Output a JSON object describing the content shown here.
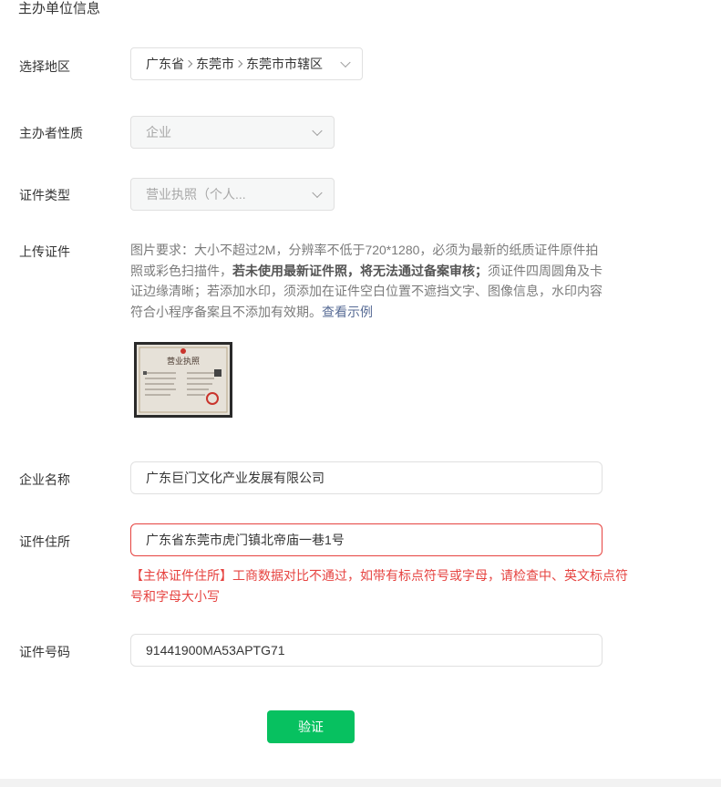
{
  "section": {
    "title": "主办单位信息"
  },
  "region": {
    "label": "选择地区",
    "province": "广东省",
    "city": "东莞市",
    "district": "东莞市市辖区"
  },
  "nature": {
    "label": "主办者性质",
    "value": "企业"
  },
  "cert_type": {
    "label": "证件类型",
    "value": "营业执照（个人..."
  },
  "upload": {
    "label": "上传证件",
    "desc_part1": "图片要求：大小不超过2M，分辨率不低于720*1280，必须为最新的纸质证件原件拍照或彩色扫描件，",
    "desc_bold": "若未使用最新证件照，将无法通过备案审核；",
    "desc_part2": "须证件四周圆角及卡证边缘清晰；若添加水印，须添加在证件空白位置不遮挡文字、图像信息，水印内容符合小程序备案且不添加有效期。",
    "example_link": "查看示例",
    "thumbnail_title": "营业执照"
  },
  "company_name": {
    "label": "企业名称",
    "value": "广东巨门文化产业发展有限公司"
  },
  "cert_address": {
    "label": "证件住所",
    "value": "广东省东莞市虎门镇北帝庙一巷1号",
    "error": "【主体证件住所】工商数据对比不通过，如带有标点符号或字母，请检查中、英文标点符号和字母大小写"
  },
  "cert_number": {
    "label": "证件号码",
    "value": "91441900MA53APTG71"
  },
  "verify_button": "验证",
  "colors": {
    "primary": "#07c160",
    "error": "#e64340",
    "link": "#576b95"
  }
}
